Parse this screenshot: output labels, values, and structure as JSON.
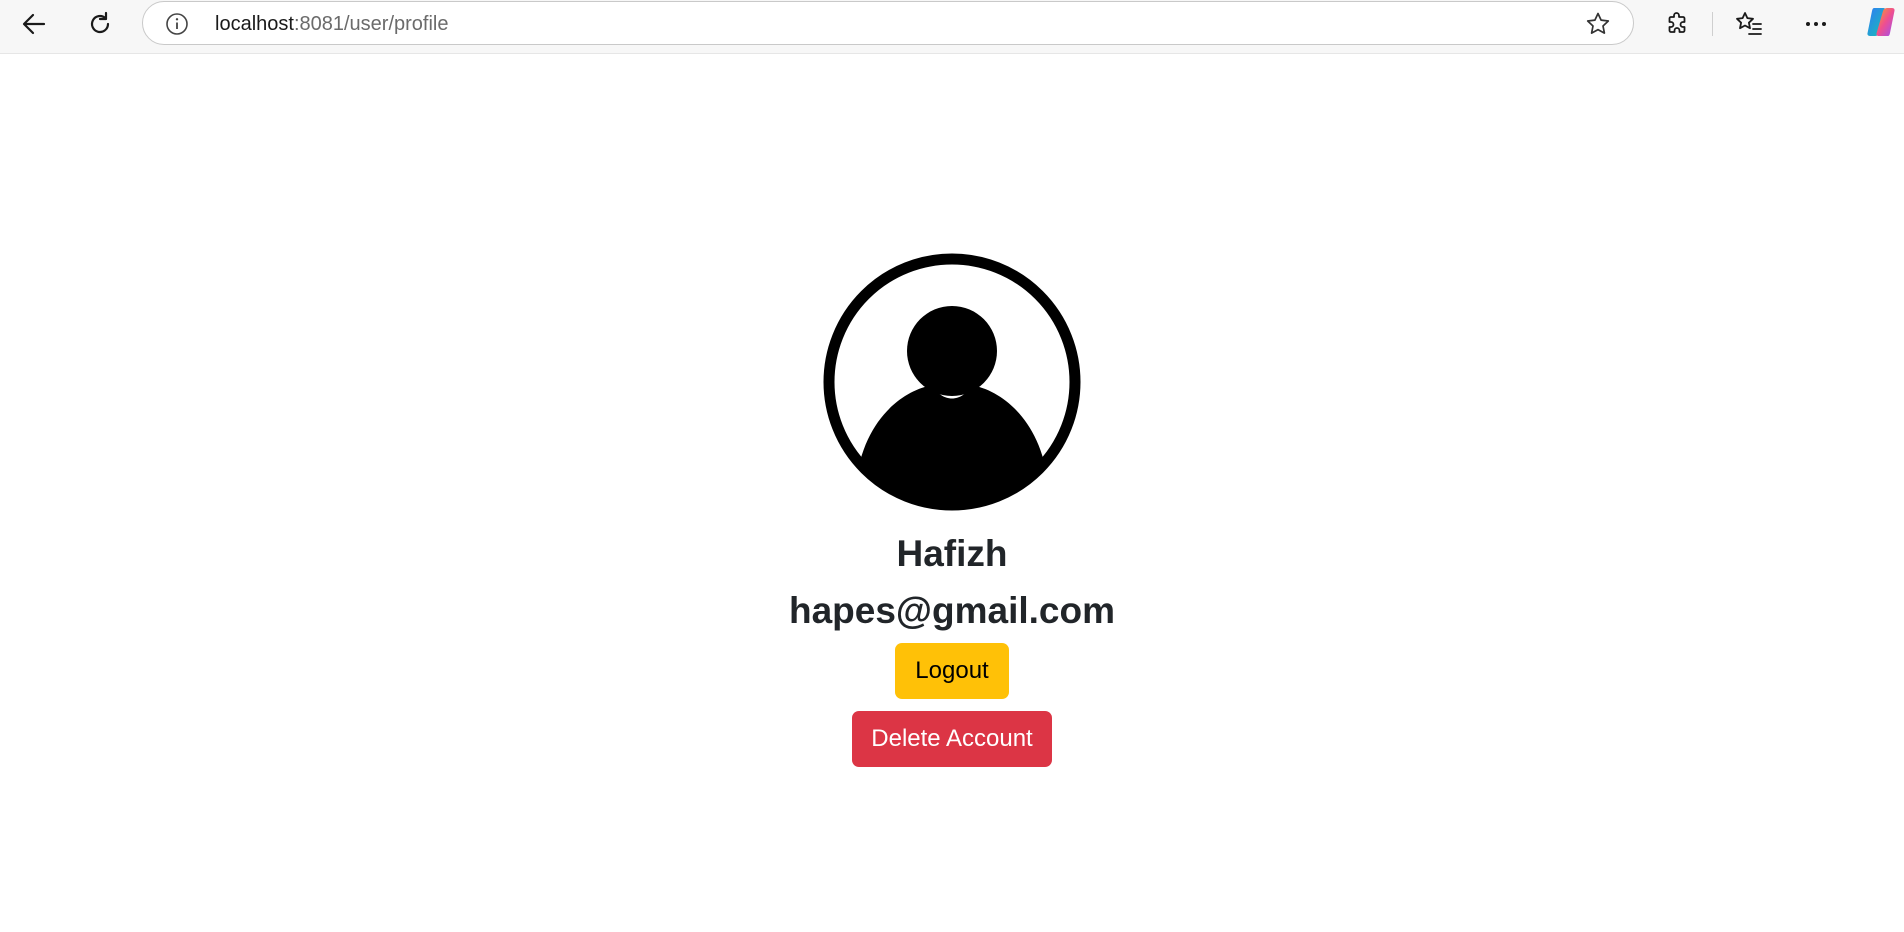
{
  "browser": {
    "url_host": "localhost",
    "url_path": ":8081/user/profile",
    "icons": {
      "back": "back-arrow-icon",
      "reload": "reload-icon",
      "site_info": "info-icon",
      "favorite": "star-icon",
      "extensions": "puzzle-icon",
      "favorites": "favorites-list-icon",
      "more": "more-dots-icon",
      "copilot": "copilot-icon"
    }
  },
  "profile": {
    "name": "Hafizh",
    "email": "hapes@gmail.com",
    "logout_label": "Logout",
    "delete_label": "Delete Account"
  },
  "colors": {
    "logout_button": "#ffc107",
    "delete_button": "#dc3545",
    "text": "#212529"
  }
}
